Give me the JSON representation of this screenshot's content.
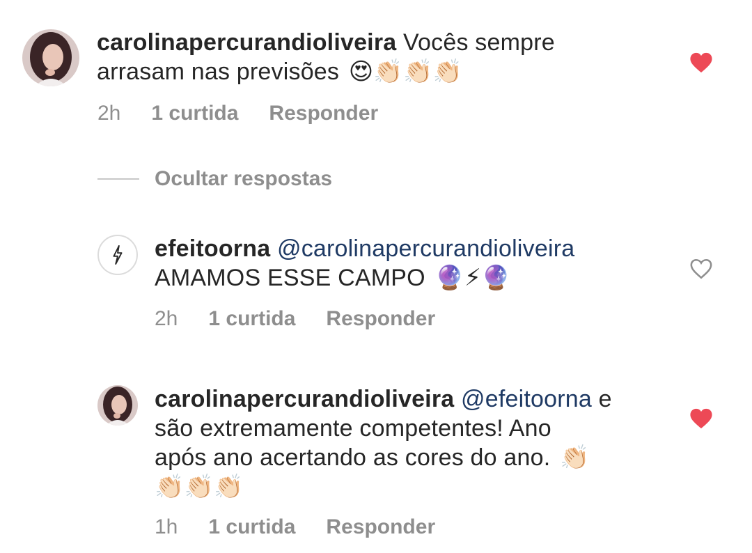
{
  "comments": [
    {
      "username": "carolinapercurandioliveira",
      "mention": "",
      "text_line1_after": " Vocês sempre",
      "text_line2": "arrasam nas previsões",
      "emojis": "😍👏🏻👏🏻👏🏻",
      "time": "2h",
      "likes": "1 curtida",
      "reply": "Responder",
      "liked": true
    },
    {
      "username": "efeitoorna",
      "mention": "@carolinapercurandioliveira",
      "text_line2": "AMAMOS ESSE CAMPO",
      "emojis": "🔮⚡🔮",
      "time": "2h",
      "likes": "1 curtida",
      "reply": "Responder",
      "liked": false
    },
    {
      "username": "carolinapercurandioliveira",
      "mention": "@efeitoorna",
      "text_line1_after": " e",
      "text_line2": "são extremamente competentes! Ano",
      "text_line3": "após ano acertando as cores do ano.",
      "emojis_line3": "👏🏻",
      "emojis_line4": "👏🏻👏🏻👏🏻",
      "time": "1h",
      "likes": "1 curtida",
      "reply": "Responder",
      "liked": true
    }
  ],
  "hide_replies": "Ocultar respostas",
  "colors": {
    "heart_filled": "#ed4956",
    "heart_outline": "#8e8e8e",
    "mention": "#1f3a64",
    "meta": "#8e8e8e"
  },
  "icons": {
    "liked": "heart-filled-icon",
    "unliked": "heart-outline-icon",
    "brand_logo": "lightning-logo"
  }
}
